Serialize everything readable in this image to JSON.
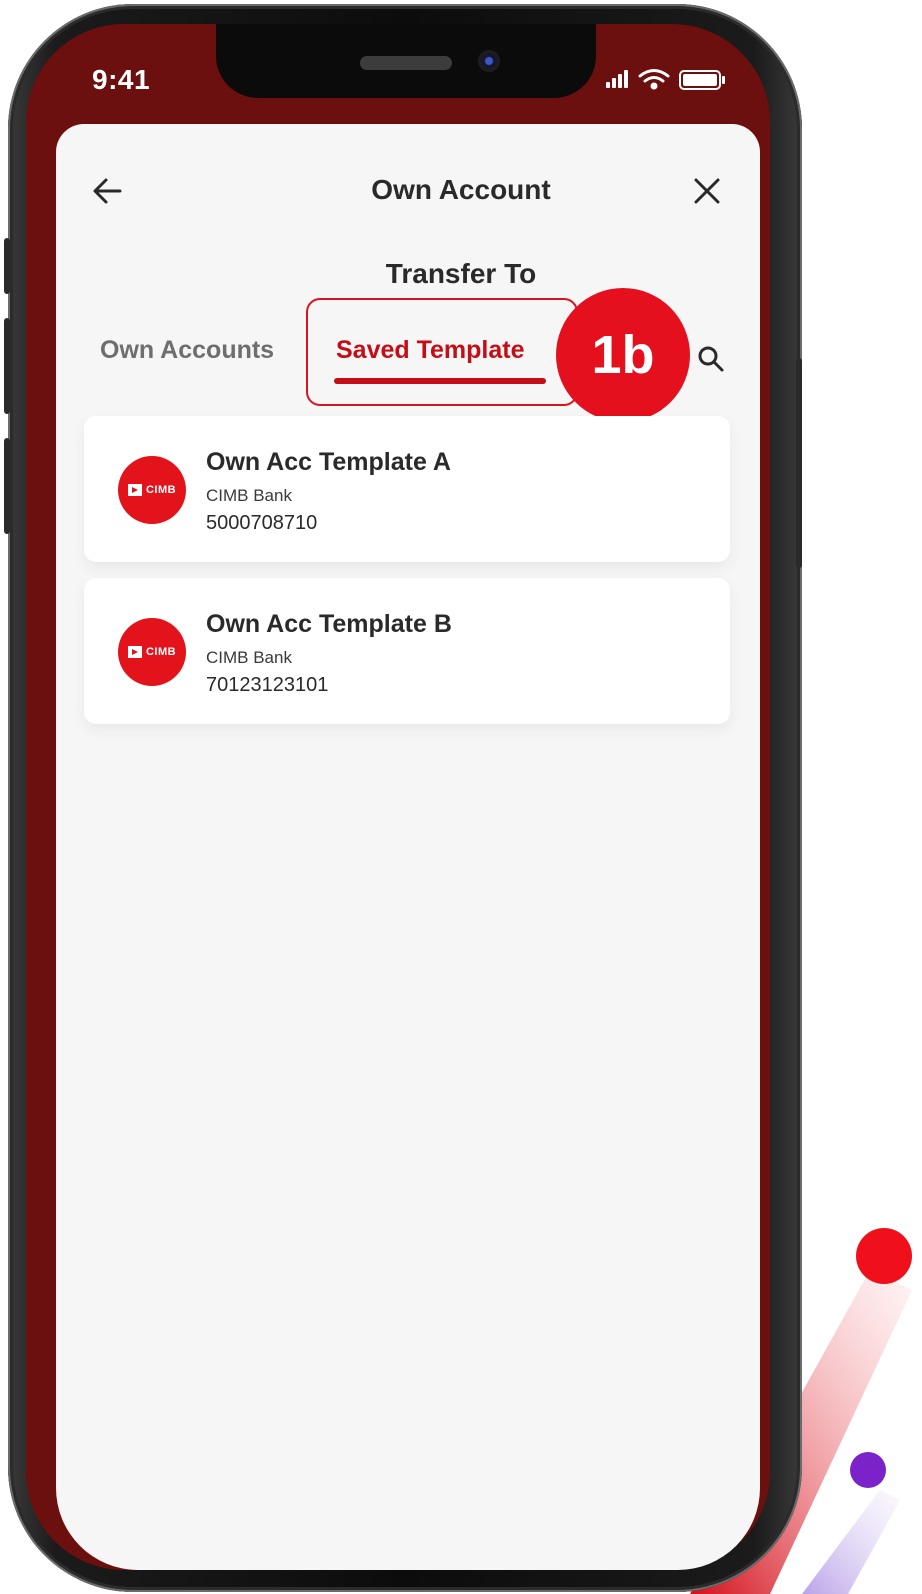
{
  "status_bar": {
    "time": "9:41"
  },
  "header": {
    "title": "Own Account",
    "back_icon": "arrow-left-icon",
    "close_icon": "close-icon"
  },
  "section": {
    "title": "Transfer To"
  },
  "tabs": [
    {
      "label": "Own Accounts",
      "active": false
    },
    {
      "label": "Saved Template",
      "active": true
    }
  ],
  "step_badge": {
    "label": "1b"
  },
  "templates": [
    {
      "name": "Own Acc Template A",
      "bank": "CIMB Bank",
      "account_number": "5000708710",
      "logo": "CIMB"
    },
    {
      "name": "Own Acc Template B",
      "bank": "CIMB Bank",
      "account_number": "70123123101",
      "logo": "CIMB"
    }
  ],
  "colors": {
    "accent": "#c40d16",
    "badge": "#e4101d",
    "header_band": "#6b0f0f"
  }
}
